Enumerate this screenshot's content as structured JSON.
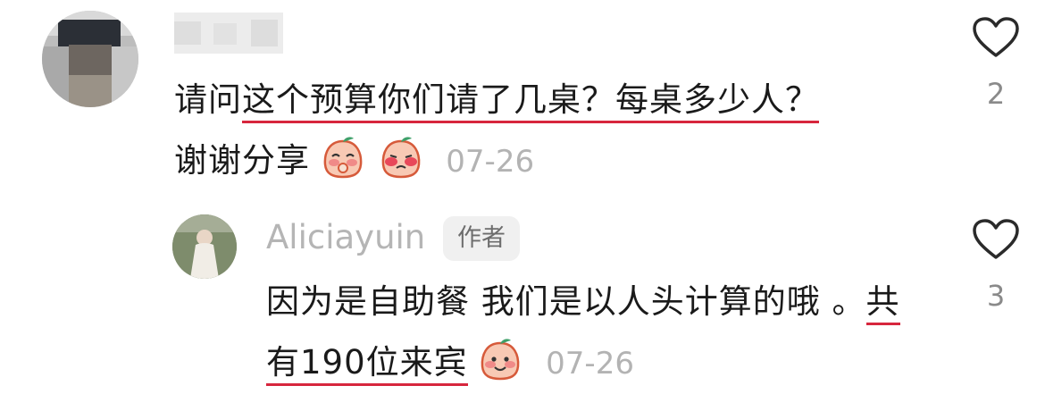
{
  "comment": {
    "text_intro": "请问",
    "text_highlight": "这个预算你们请了几桌？每桌多少人？",
    "text_rest": "谢谢分享",
    "emojis": [
      "blushing-peach-emoji",
      "shy-peach-emoji"
    ],
    "date": "07-26",
    "like_count": "2"
  },
  "reply": {
    "username": "Aliciayuin",
    "badge": "作者",
    "text_first": "因为是自助餐 我们是以人头计算的哦 。",
    "text_highlight": "共有190位来宾",
    "emojis": [
      "smiling-peach-emoji"
    ],
    "date": "07-26",
    "like_count": "3"
  },
  "colors": {
    "underline": "#d7263d",
    "muted": "#b3b3b3"
  }
}
